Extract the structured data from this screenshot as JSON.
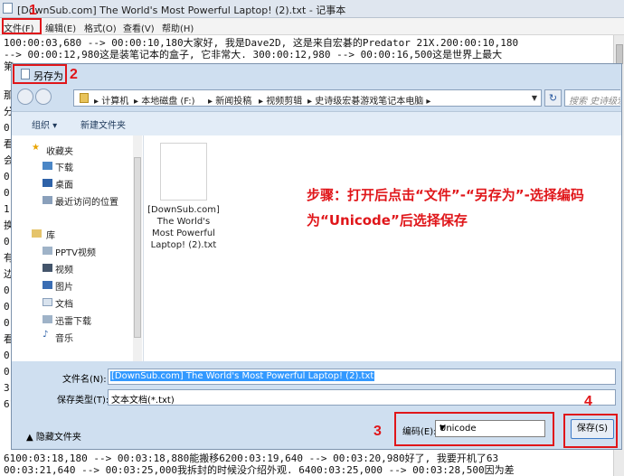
{
  "notepad": {
    "title": "[DownSub.com] The World's Most Powerful Laptop! (2).txt - 记事本",
    "menu": [
      "文件(F)",
      "编辑(E)",
      "格式(O)",
      "查看(V)",
      "帮助(H)"
    ],
    "lines": [
      "100:00:03,680 --> 00:00:10,180大家好, 我是Dave2D, 这是来自宏碁的Predator 21X.200:00:10,180",
      "--> 00:00:12,980这是装笔记本的盒子, 它非常大. 300:00:12,980 --> 00:00:16,500这是世界上最大",
      "6100:03:18,180 --> 00:03:18,880能搬移6200:03:19,640 --> 00:03:20,980好了, 我要开机了63",
      "00:03:21,640 --> 00:03:25,000我拆封的时候没介绍外观. 6400:03:25,000 --> 00:03:28,500因为差"
    ],
    "left_fragments": [
      "第",
      "那",
      "分",
      "0",
      "看",
      "会",
      "0",
      "0",
      "1",
      "换",
      "0",
      "有",
      "边",
      "0",
      "0",
      "0",
      "看",
      "0",
      "0",
      "3",
      "6100"
    ]
  },
  "annotations": {
    "step1": "1",
    "step2": "2",
    "step3": "3",
    "step4": "4",
    "instruction": "步骤：打开后点击“文件”-“另存为”-选择编码为“Unicode”后选择保存"
  },
  "dialog": {
    "title": "另存为",
    "breadcrumbs": [
      "计算机",
      "本地磁盘 (F:)",
      "新闻投稿",
      "视频剪辑",
      "史诗级宏碁游戏笔记本电脑"
    ],
    "search_placeholder": "搜索 史诗级宏碁...",
    "toolbar": {
      "organize": "组织 ▾",
      "new_folder": "新建文件夹"
    },
    "favorites_header": "收藏夹",
    "favorites": [
      "下载",
      "桌面",
      "最近访问的位置"
    ],
    "library_header": "库",
    "library": [
      "PPTV视频",
      "视频",
      "图片",
      "文档",
      "迅雷下载",
      "音乐"
    ],
    "file_label": "[DownSub.com] The World's Most Powerful Laptop! (2).txt",
    "filename_label": "文件名(N):",
    "filename_value": "[DownSub.com] The World's Most Powerful Laptop! (2).txt",
    "filetype_label": "保存类型(T):",
    "filetype_value": "文本文档(*.txt)",
    "hide_folders": "隐藏文件夹",
    "encoding_label": "编码(E):",
    "encoding_value": "Unicode",
    "save_button": "保存(S)"
  }
}
